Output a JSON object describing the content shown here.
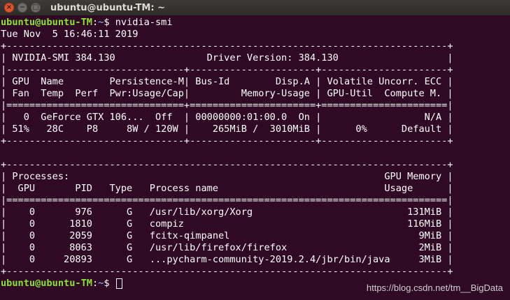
{
  "window": {
    "title": "ubuntu@ubuntu-TM: ~",
    "close_glyph": "×",
    "minimize_glyph": "−",
    "maximize_glyph": "□"
  },
  "prompt": {
    "user_host": "ubuntu@ubuntu-TM",
    "colon": ":",
    "path": "~",
    "symbol": "$ ",
    "command": "nvidia-smi"
  },
  "output_lines": [
    "Tue Nov  5 16:46:11 2019       ",
    "+-----------------------------------------------------------------------------+",
    "| NVIDIA-SMI 384.130                Driver Version: 384.130                   |",
    "|-------------------------------+----------------------+----------------------+",
    "| GPU  Name        Persistence-M| Bus-Id        Disp.A | Volatile Uncorr. ECC |",
    "| Fan  Temp  Perf  Pwr:Usage/Cap|         Memory-Usage | GPU-Util  Compute M. |",
    "|===============================+======================+======================|",
    "|   0  GeForce GTX 106...  Off  | 00000000:01:00.0  On |                  N/A |",
    "| 51%   28C    P8     8W / 120W |    265MiB /  3010MiB |      0%      Default |",
    "+-------------------------------+----------------------+----------------------+",
    "                                                                               ",
    "+-----------------------------------------------------------------------------+",
    "| Processes:                                                       GPU Memory |",
    "|  GPU       PID   Type   Process name                             Usage      |",
    "|=============================================================================|",
    "|    0       976      G   /usr/lib/xorg/Xorg                           131MiB |",
    "|    0      1810      G   compiz                                       116MiB |",
    "|    0      2059      G   fcitx-qimpanel                                 9MiB |",
    "|    0      8063      G   /usr/lib/firefox/firefox                       2MiB |",
    "|    0     20893      G   ...pycharm-community-2019.2.4/jbr/bin/java     3MiB |",
    "+-----------------------------------------------------------------------------+"
  ],
  "watermark": "https://blog.csdn.net/tm__BigData",
  "colors": {
    "background": "#300a24",
    "prompt_user": "#8ae234",
    "prompt_path": "#729fcf",
    "text": "#ffffff"
  }
}
